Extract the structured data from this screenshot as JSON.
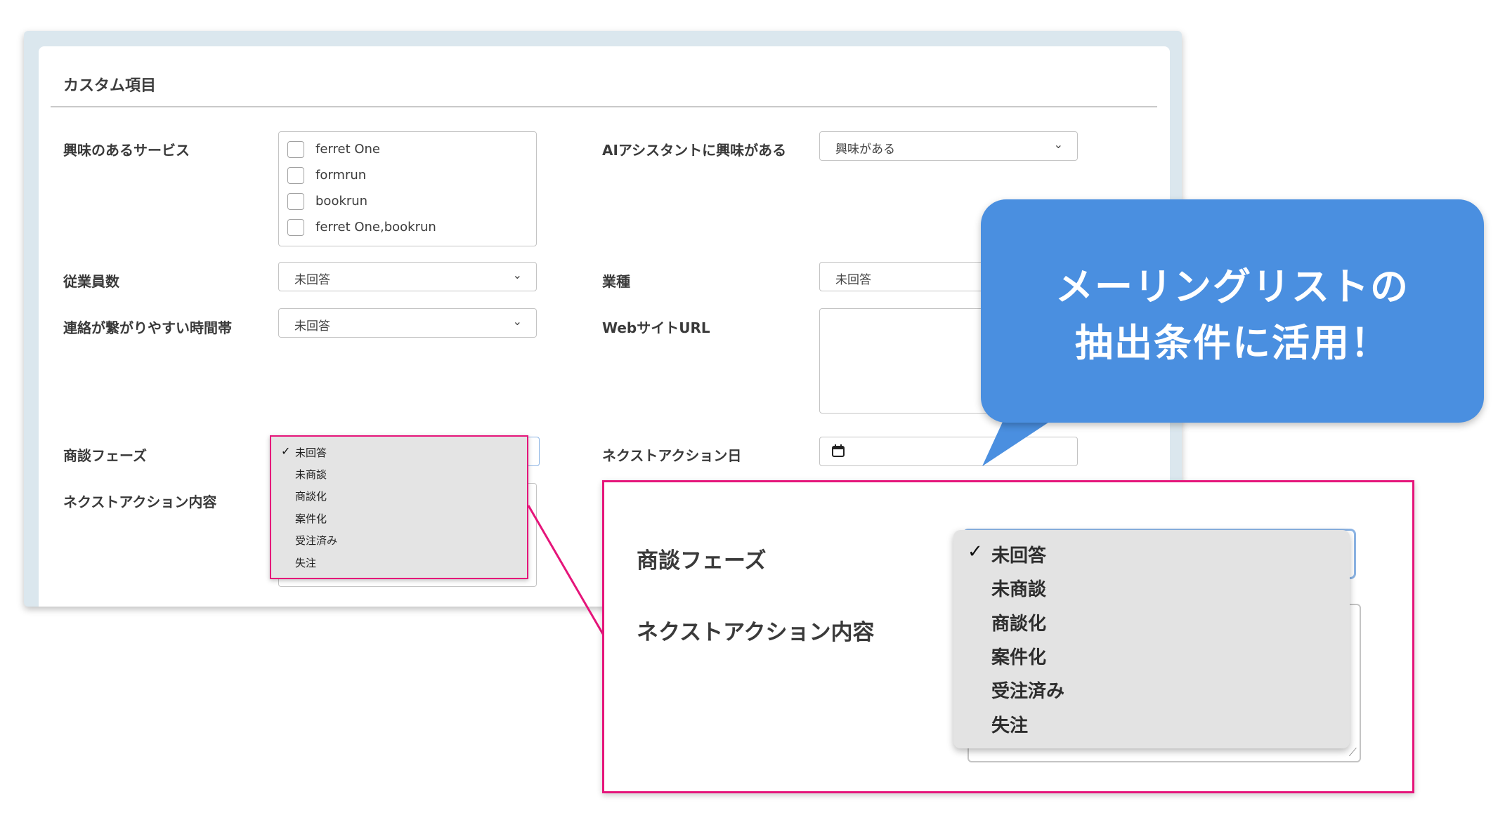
{
  "section": {
    "title": "カスタム項目"
  },
  "fields": {
    "interested_services": {
      "label": "興味のあるサービス",
      "options": [
        "ferret One",
        "formrun",
        "bookrun",
        "ferret One,bookrun"
      ]
    },
    "ai_assistant": {
      "label": "AIアシスタントに興味がある",
      "value": "興味がある"
    },
    "employees": {
      "label": "従業員数",
      "value": "未回答"
    },
    "industry": {
      "label": "業種",
      "value": "未回答"
    },
    "contact_time": {
      "label": "連絡が繋がりやすい時間帯",
      "value": "未回答"
    },
    "website_url": {
      "label": "WebサイトURL",
      "value": ""
    },
    "deal_phase": {
      "label": "商談フェーズ",
      "selected": "未回答"
    },
    "next_action_date": {
      "label": "ネクストアクション日"
    },
    "next_action_content": {
      "label": "ネクストアクション内容"
    }
  },
  "deal_phase_options": [
    "未回答",
    "未商談",
    "商談化",
    "案件化",
    "受注済み",
    "失注"
  ],
  "check_mark": "✓",
  "bubble": {
    "line1": "メーリングリストの",
    "line2": "抽出条件に活用！"
  },
  "colors": {
    "highlight": "#e5157a",
    "bubble": "#4a8fe0",
    "card_border": "#dbe7ee"
  }
}
